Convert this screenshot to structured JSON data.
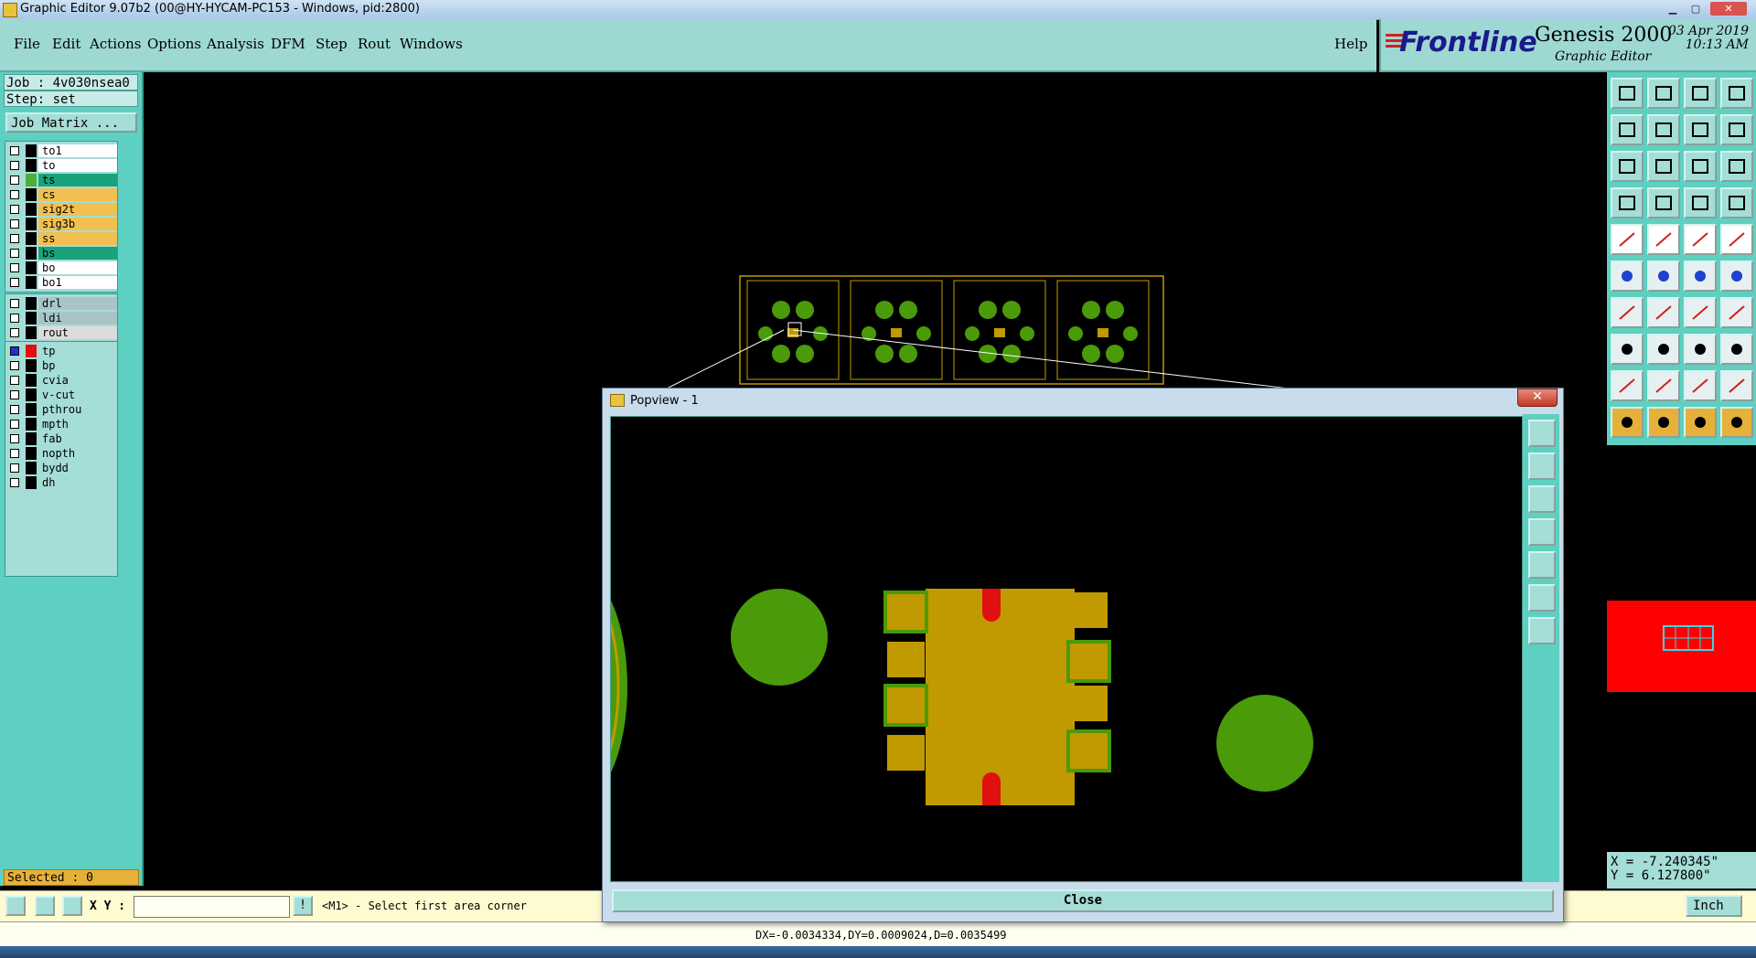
{
  "window": {
    "title": "Graphic Editor 9.07b2 (00@HY-HYCAM-PC153 - Windows, pid:2800)"
  },
  "menu": {
    "items": [
      "File",
      "Edit",
      "Actions",
      "Options",
      "Analysis",
      "DFM",
      "Step",
      "Rout",
      "Windows"
    ],
    "help": "Help"
  },
  "brand": {
    "logo": "Frontline",
    "product": "Genesis 2000",
    "subtitle": "Graphic Editor",
    "date": "03 Apr 2019",
    "time": "10:13 AM"
  },
  "left_panel": {
    "job": "Job : 4v030nsea0",
    "step": "Step: set",
    "job_matrix": "Job Matrix ...",
    "groups": [
      [
        {
          "name": "to1",
          "color": "#ffffff",
          "swatch": ""
        },
        {
          "name": "to",
          "color": "#ffffff",
          "swatch": ""
        },
        {
          "name": "ts",
          "color": "#1aa37a",
          "swatch": "#4caf3a"
        },
        {
          "name": "cs",
          "color": "#f2c050",
          "swatch": ""
        },
        {
          "name": "sig2t",
          "color": "#f2c050",
          "swatch": ""
        },
        {
          "name": "sig3b",
          "color": "#f2c050",
          "swatch": ""
        },
        {
          "name": "ss",
          "color": "#f2c050",
          "swatch": ""
        },
        {
          "name": "bs",
          "color": "#1aa37a",
          "swatch": ""
        },
        {
          "name": "bo",
          "color": "#ffffff",
          "swatch": ""
        },
        {
          "name": "bo1",
          "color": "#ffffff",
          "swatch": ""
        }
      ],
      [
        {
          "name": "drl",
          "color": "#a9c4c8",
          "swatch": ""
        },
        {
          "name": "ldi",
          "color": "#a9c4c8",
          "swatch": ""
        },
        {
          "name": "rout",
          "color": "#dcdcdc",
          "swatch": ""
        }
      ],
      [
        {
          "name": "tp",
          "color": "#a5ddd7",
          "swatch": "#e01010"
        },
        {
          "name": "bp",
          "color": "#a5ddd7",
          "swatch": ""
        },
        {
          "name": "cvia",
          "color": "#a5ddd7",
          "swatch": ""
        },
        {
          "name": "v-cut",
          "color": "#a5ddd7",
          "swatch": ""
        },
        {
          "name": "pthrou",
          "color": "#a5ddd7",
          "swatch": ""
        },
        {
          "name": "mpth",
          "color": "#a5ddd7",
          "swatch": ""
        },
        {
          "name": "fab",
          "color": "#a5ddd7",
          "swatch": ""
        },
        {
          "name": "nopth",
          "color": "#a5ddd7",
          "swatch": ""
        },
        {
          "name": "bydd",
          "color": "#a5ddd7",
          "swatch": ""
        },
        {
          "name": "dh",
          "color": "#a5ddd7",
          "swatch": ""
        }
      ]
    ],
    "selected": "Selected : 0"
  },
  "popview": {
    "title": "Popview - 1",
    "close_x": "✕",
    "close_button": "Close"
  },
  "coordinates": {
    "x": "X = -7.240345\"",
    "y": "Y =  6.127800\""
  },
  "bottom": {
    "xy_label": "X Y :",
    "xy_value": "",
    "prompt": "<M1> - Select first area corner",
    "unit": "Inch",
    "status": "DX=-0.0034334,DY=0.0009024,D=0.0035499"
  },
  "colors": {
    "panel": "#5ed0c1",
    "menubar": "#9ed8d2",
    "copper": "#c09a00",
    "mask": "#4a9a0a",
    "overview_red": "#ff0000"
  }
}
